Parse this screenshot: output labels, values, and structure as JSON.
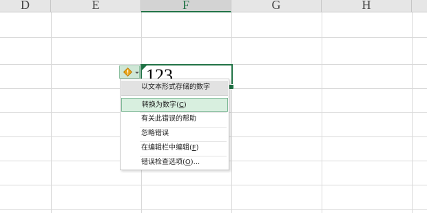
{
  "columns": {
    "d": "D",
    "e": "E",
    "f": "F",
    "g": "G",
    "h": "H"
  },
  "active_cell": {
    "value": "123"
  },
  "error_menu": {
    "header": "以文本形式存储的数字",
    "items": [
      {
        "label": "转换为数字(",
        "hotkey": "C",
        "suffix": ")"
      },
      {
        "label": "有关此错误的帮助",
        "hotkey": "",
        "suffix": ""
      },
      {
        "label": "忽略错误",
        "hotkey": "",
        "suffix": ""
      },
      {
        "label": "在编辑栏中编辑(",
        "hotkey": "F",
        "suffix": ")"
      },
      {
        "label": "错误检查选项(",
        "hotkey": "O",
        "suffix": ")..."
      }
    ]
  },
  "icons": {
    "error_button": "warning-diamond-icon",
    "dropdown": "dropdown-arrow-icon"
  },
  "colors": {
    "accent": "#217346",
    "warning": "#e8a317",
    "highlight": "#d8efdf"
  }
}
